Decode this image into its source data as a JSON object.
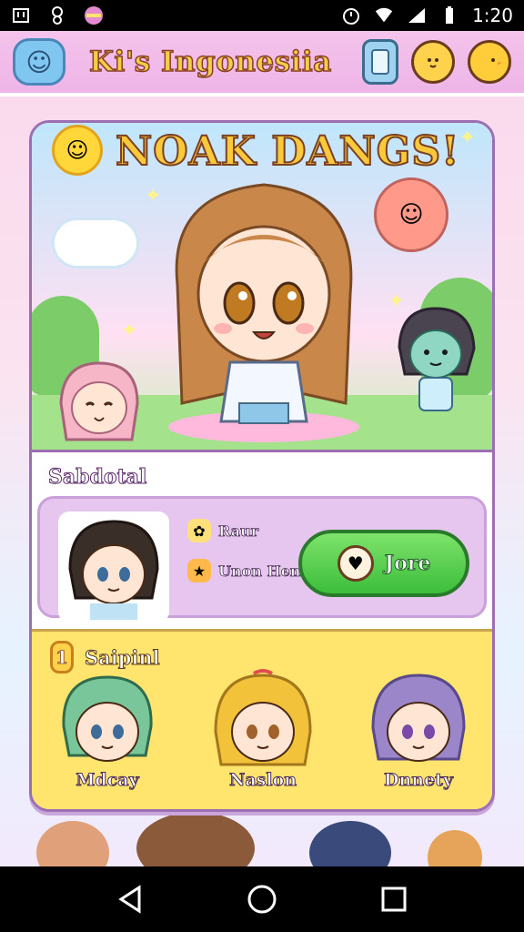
{
  "status_bar": {
    "time": "1:20"
  },
  "header": {
    "title": "Ki's Ingonesiia",
    "icons": [
      "mascot-icon",
      "phone-icon",
      "chick-icon",
      "bird-icon"
    ]
  },
  "hero": {
    "title": "NOAK DANGS!",
    "characters": [
      "main-character",
      "pink-character",
      "teal-character"
    ]
  },
  "featured": {
    "label": "Sabdotal",
    "meta": [
      {
        "icon": "flower-icon",
        "text": "Raur"
      },
      {
        "icon": "star-icon",
        "text": "Unon Henk"
      }
    ],
    "join_label": "Jore",
    "join_icon": "heart-icon"
  },
  "lower": {
    "number": "1",
    "title": "Saipinl",
    "friends": [
      {
        "name": "Mdcay",
        "hair": "#79c69b"
      },
      {
        "name": "Naslon",
        "hair": "#f2c23a"
      },
      {
        "name": "Dnnety",
        "hair": "#9a86c9"
      }
    ]
  },
  "colors": {
    "accent": "#f2d045",
    "panel": "#e6c5ef",
    "button": "#3cbd3a",
    "lower_panel": "#ffe56e"
  }
}
